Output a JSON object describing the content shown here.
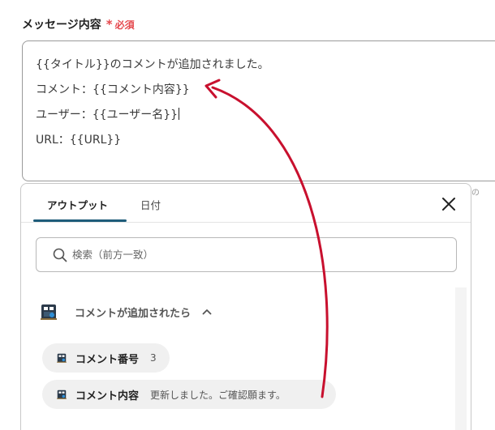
{
  "field": {
    "label": "メッセージ内容",
    "required_mark": "*",
    "required_text": "必須"
  },
  "message": {
    "lines": [
      "{{タイトル}}のコメントが追加されました。",
      "コメント：{{コメント内容}}",
      "ユーザー：{{ユーザー名}}",
      "URL：{{URL}}"
    ]
  },
  "side_hint": "の",
  "panel": {
    "tabs": [
      {
        "label": "アウトプット",
        "active": true
      },
      {
        "label": "日付",
        "active": false
      }
    ],
    "close_icon": "close-icon",
    "search": {
      "placeholder": "検索（前方一致）",
      "value": ""
    },
    "group": {
      "title": "コメントが追加されたら",
      "expanded": true,
      "icon": "app-logo-icon"
    },
    "items": [
      {
        "label": "コメント番号",
        "value": "3"
      },
      {
        "label": "コメント内容",
        "value": "更新しました。ご確認願ます。"
      }
    ]
  },
  "colors": {
    "required": "#e5484d",
    "tab_underline": "#1e5c7a",
    "annotation_arrow": "#c8102e"
  }
}
